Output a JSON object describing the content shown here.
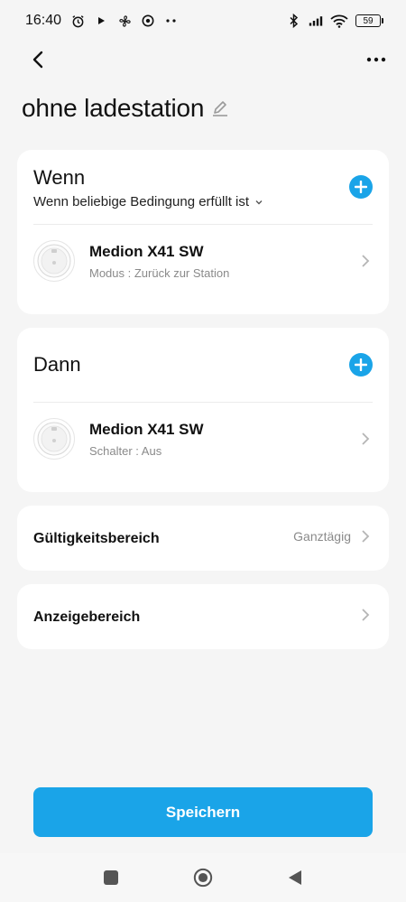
{
  "status_bar": {
    "time": "16:40",
    "battery": "59",
    "icons": [
      "alarm-icon",
      "play-icon",
      "fan-icon",
      "chrome-icon",
      "more-dots-icon",
      "bluetooth-icon",
      "signal-icon",
      "wifi-icon",
      "battery-icon"
    ]
  },
  "header": {
    "title": "ohne ladestation"
  },
  "when_section": {
    "heading": "Wenn",
    "condition": "Wenn beliebige Bedingung erfüllt ist",
    "device": {
      "name": "Medion  X41 SW",
      "detail": "Modus : Zurück zur Station"
    }
  },
  "then_section": {
    "heading": "Dann",
    "device": {
      "name": "Medion  X41 SW",
      "detail": "Schalter : Aus"
    }
  },
  "validity": {
    "label": "Gültigkeitsbereich",
    "value": "Ganztägig"
  },
  "display": {
    "label": "Anzeigebereich"
  },
  "save_button": {
    "label": "Speichern"
  },
  "colors": {
    "accent": "#1aa4e8",
    "background": "#f5f5f5",
    "card": "#ffffff",
    "muted_text": "#8a8a8a"
  }
}
